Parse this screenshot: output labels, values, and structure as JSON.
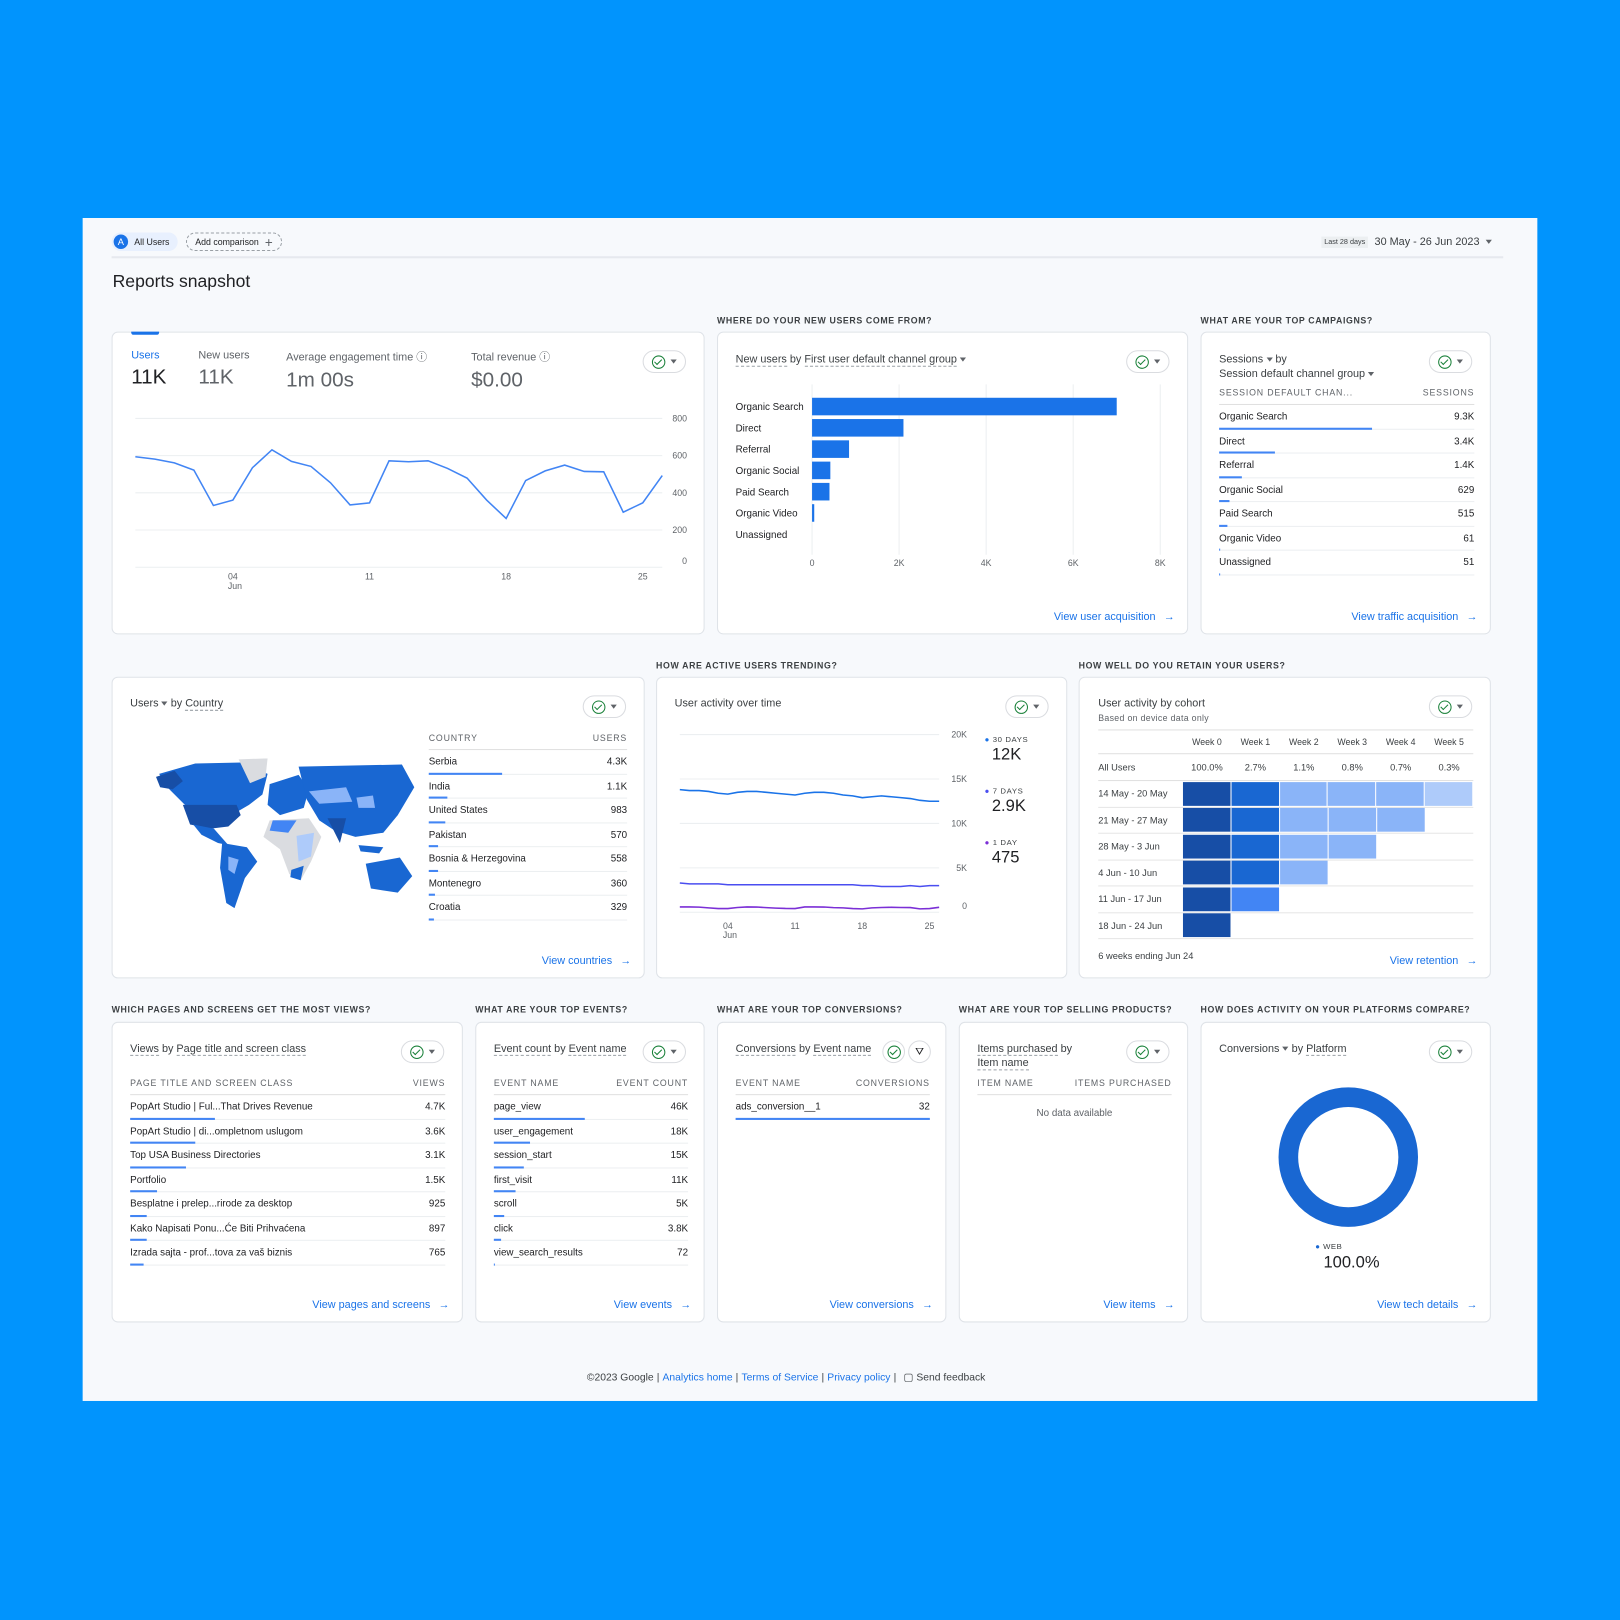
{
  "header": {
    "segment_badge": "A",
    "segment_label": "All Users",
    "add_comparison": "Add comparison",
    "date_preset": "Last 28 days",
    "date_range": "30 May - 26 Jun 2023"
  },
  "page_title": "Reports snapshot",
  "overview": {
    "metrics": [
      {
        "label": "Users",
        "value": "11K"
      },
      {
        "label": "New users",
        "value": "11K"
      },
      {
        "label": "Average engagement time",
        "value": "1m 00s"
      },
      {
        "label": "Total revenue",
        "value": "$0.00"
      }
    ]
  },
  "acquisition": {
    "section": "WHERE DO YOUR NEW USERS COME FROM?",
    "metric": "New users",
    "by": "by",
    "dimension": "First user default channel group",
    "link": "View user acquisition"
  },
  "campaigns": {
    "section": "WHAT ARE YOUR TOP CAMPAIGNS?",
    "metric": "Sessions",
    "by": "by",
    "dimension": "Session default channel group",
    "col1": "SESSION DEFAULT CHAN...",
    "col2": "SESSIONS",
    "rows": [
      {
        "name": "Organic Search",
        "value": "9.3K"
      },
      {
        "name": "Direct",
        "value": "3.4K"
      },
      {
        "name": "Referral",
        "value": "1.4K"
      },
      {
        "name": "Organic Social",
        "value": "629"
      },
      {
        "name": "Paid Search",
        "value": "515"
      },
      {
        "name": "Organic Video",
        "value": "61"
      },
      {
        "name": "Unassigned",
        "value": "51"
      }
    ],
    "link": "View traffic acquisition"
  },
  "countries": {
    "metric": "Users",
    "by": "by",
    "dimension": "Country",
    "col1": "COUNTRY",
    "col2": "USERS",
    "rows": [
      {
        "name": "Serbia",
        "value": "4.3K"
      },
      {
        "name": "India",
        "value": "1.1K"
      },
      {
        "name": "United States",
        "value": "983"
      },
      {
        "name": "Pakistan",
        "value": "570"
      },
      {
        "name": "Bosnia & Herzegovina",
        "value": "558"
      },
      {
        "name": "Montenegro",
        "value": "360"
      },
      {
        "name": "Croatia",
        "value": "329"
      }
    ],
    "link": "View countries"
  },
  "activity": {
    "section": "HOW ARE ACTIVE USERS TRENDING?",
    "title": "User activity over time",
    "legend": [
      {
        "label": "30 DAYS",
        "value": "12K",
        "color": "#1a73e8"
      },
      {
        "label": "7 DAYS",
        "value": "2.9K",
        "color": "#4a4ef0"
      },
      {
        "label": "1 DAY",
        "value": "475",
        "color": "#7b2fd6"
      }
    ]
  },
  "retention": {
    "section": "HOW WELL DO YOU RETAIN YOUR USERS?",
    "title": "User activity by cohort",
    "subtitle": "Based on device data only",
    "weeks": [
      "Week 0",
      "Week 1",
      "Week 2",
      "Week 3",
      "Week 4",
      "Week 5"
    ],
    "all_users_label": "All Users",
    "all_users": [
      "100.0%",
      "2.7%",
      "1.1%",
      "0.8%",
      "0.7%",
      "0.3%"
    ],
    "cohorts": [
      {
        "label": "14 May - 20 May",
        "cells": 6
      },
      {
        "label": "21 May - 27 May",
        "cells": 5
      },
      {
        "label": "28 May - 3 Jun",
        "cells": 4
      },
      {
        "label": "4 Jun - 10 Jun",
        "cells": 3
      },
      {
        "label": "11 Jun - 17 Jun",
        "cells": 2
      },
      {
        "label": "18 Jun - 24 Jun",
        "cells": 1
      }
    ],
    "colors": {
      "week0": "#174ea6",
      "week1": "#1967d2",
      "week1_recent": "#4285f4",
      "mid": "#8ab4f8",
      "light": "#aecbfa"
    },
    "footer": "6 weeks ending Jun 24",
    "link": "View retention"
  },
  "pages": {
    "section": "WHICH PAGES AND SCREENS GET THE MOST VIEWS?",
    "metric": "Views",
    "by": "by",
    "dimension": "Page title and screen class",
    "col1": "PAGE TITLE AND SCREEN CLASS",
    "col2": "VIEWS",
    "rows": [
      {
        "name": "PopArt Studio | Ful...That Drives Revenue",
        "value": "4.7K"
      },
      {
        "name": "PopArt Studio | di...ompletnom uslugom",
        "value": "3.6K"
      },
      {
        "name": "Top USA Business Directories",
        "value": "3.1K"
      },
      {
        "name": "Portfolio",
        "value": "1.5K"
      },
      {
        "name": "Besplatne i prelep...rirode za desktop",
        "value": "925"
      },
      {
        "name": "Kako Napisati Ponu...Će Biti Prihvaćena",
        "value": "897"
      },
      {
        "name": "Izrada sajta - prof...tova za vaš biznis",
        "value": "765"
      }
    ],
    "link": "View pages and screens"
  },
  "events": {
    "section": "WHAT ARE YOUR TOP EVENTS?",
    "metric": "Event count",
    "by": "by",
    "dimension": "Event name",
    "col1": "EVENT NAME",
    "col2": "EVENT COUNT",
    "rows": [
      {
        "name": "page_view",
        "value": "46K"
      },
      {
        "name": "user_engagement",
        "value": "18K"
      },
      {
        "name": "session_start",
        "value": "15K"
      },
      {
        "name": "first_visit",
        "value": "11K"
      },
      {
        "name": "scroll",
        "value": "5K"
      },
      {
        "name": "click",
        "value": "3.8K"
      },
      {
        "name": "view_search_results",
        "value": "72"
      }
    ],
    "link": "View events"
  },
  "conversions": {
    "section": "WHAT ARE YOUR TOP CONVERSIONS?",
    "metric": "Conversions",
    "by": "by",
    "dimension": "Event name",
    "col1": "EVENT NAME",
    "col2": "CONVERSIONS",
    "rows": [
      {
        "name": "ads_conversion__1",
        "value": "32"
      }
    ],
    "link": "View conversions"
  },
  "products": {
    "section": "WHAT ARE YOUR TOP SELLING PRODUCTS?",
    "metric": "Items purchased",
    "by": "by",
    "dimension": "Item name",
    "col1": "ITEM NAME",
    "col2": "ITEMS PURCHASED",
    "empty": "No data available",
    "link": "View items"
  },
  "platforms": {
    "section": "HOW DOES ACTIVITY ON YOUR PLATFORMS COMPARE?",
    "metric": "Conversions",
    "by": "by",
    "dimension": "Platform",
    "legend_label": "WEB",
    "legend_value": "100.0%",
    "link": "View tech details"
  },
  "footer": {
    "copyright": "©2023 Google",
    "links": [
      "Analytics home",
      "Terms of Service",
      "Privacy policy"
    ],
    "feedback": "Send feedback"
  },
  "chart_data": [
    {
      "type": "line",
      "x": [
        "30 May",
        "31 May",
        "1 Jun",
        "2 Jun",
        "3 Jun",
        "4 Jun",
        "5 Jun",
        "6 Jun",
        "7 Jun",
        "8 Jun",
        "9 Jun",
        "10 Jun",
        "11 Jun",
        "12 Jun",
        "13 Jun",
        "14 Jun",
        "15 Jun",
        "16 Jun",
        "17 Jun",
        "18 Jun",
        "19 Jun",
        "20 Jun",
        "21 Jun",
        "22 Jun",
        "23 Jun",
        "24 Jun",
        "25 Jun",
        "26 Jun"
      ],
      "series": [
        {
          "name": "Users",
          "values": [
            594,
            581,
            561,
            522,
            332,
            361,
            535,
            631,
            569,
            542,
            454,
            335,
            346,
            572,
            567,
            572,
            531,
            479,
            361,
            262,
            466,
            518,
            549,
            515,
            513,
            296,
            346,
            493
          ]
        }
      ],
      "xticks": [
        {
          "index": 5,
          "label": "04",
          "sub": "Jun"
        },
        {
          "index": 12,
          "label": "11"
        },
        {
          "index": 19,
          "label": "18"
        },
        {
          "index": 26,
          "label": "25"
        }
      ],
      "yticks": [
        "0",
        "200",
        "400",
        "600",
        "800"
      ],
      "ylim": [
        0,
        800
      ],
      "color": "#4285f4"
    },
    {
      "type": "bar",
      "orientation": "horizontal",
      "categories": [
        "Organic Search",
        "Direct",
        "Referral",
        "Organic Social",
        "Paid Search",
        "Organic Video",
        "Unassigned"
      ],
      "values": [
        7000,
        2100,
        850,
        420,
        400,
        50,
        0
      ],
      "xticks": [
        "0",
        "2K",
        "4K",
        "6K",
        "8K"
      ],
      "xlim": [
        0,
        8000
      ],
      "color": "#1a73e8"
    },
    {
      "type": "line",
      "x_ref": "30 May - 26 Jun",
      "xticks": [
        {
          "index": 5,
          "label": "04",
          "sub": "Jun"
        },
        {
          "index": 12,
          "label": "11"
        },
        {
          "index": 19,
          "label": "18"
        },
        {
          "index": 26,
          "label": "25"
        }
      ],
      "yticks": [
        "0",
        "5K",
        "10K",
        "15K",
        "20K"
      ],
      "ylim": [
        0,
        20000
      ],
      "series": [
        {
          "name": "30 DAYS",
          "values": [
            13800,
            13700,
            13700,
            13600,
            13400,
            13300,
            13500,
            13600,
            13600,
            13500,
            13400,
            13300,
            13200,
            13400,
            13500,
            13500,
            13400,
            13200,
            13100,
            12900,
            13000,
            13100,
            13000,
            12900,
            12800,
            12600,
            12500,
            12500
          ]
        },
        {
          "name": "7 DAYS",
          "values": [
            3300,
            3200,
            3200,
            3200,
            3200,
            3100,
            3100,
            3100,
            3100,
            3100,
            3100,
            3100,
            3100,
            3100,
            3100,
            3100,
            3100,
            3100,
            3100,
            3000,
            3000,
            2900,
            2900,
            2900,
            3000,
            2900,
            3000,
            3000
          ]
        },
        {
          "name": "1 DAY",
          "values": [
            600,
            600,
            580,
            500,
            420,
            420,
            540,
            600,
            590,
            520,
            470,
            430,
            420,
            600,
            600,
            590,
            520,
            500,
            420,
            380,
            500,
            540,
            560,
            540,
            530,
            380,
            420,
            560
          ]
        }
      ]
    },
    {
      "type": "pie",
      "categories": [
        "WEB"
      ],
      "values": [
        100
      ],
      "color": "#1967d2"
    }
  ]
}
